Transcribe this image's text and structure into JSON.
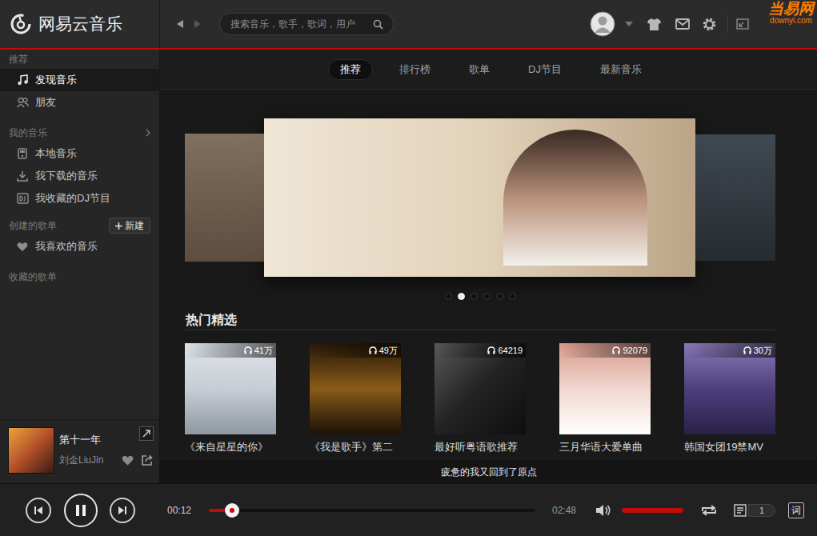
{
  "app": {
    "title": "网易云音乐"
  },
  "watermark": {
    "name": "当易网",
    "url": "downyi.com"
  },
  "search": {
    "placeholder": "搜索音乐，歌手，歌词，用户"
  },
  "sidebar": {
    "sections": [
      {
        "title": "推荐",
        "expandable": false,
        "items": [
          {
            "label": "发现音乐",
            "selected": true
          },
          {
            "label": "朋友",
            "selected": false
          }
        ]
      },
      {
        "title": "我的音乐",
        "expandable": true,
        "items": [
          {
            "label": "本地音乐",
            "selected": false
          },
          {
            "label": "我下载的音乐",
            "selected": false
          },
          {
            "label": "我收藏的DJ节目",
            "selected": false
          }
        ]
      },
      {
        "title": "创建的歌单",
        "expandable": false,
        "button": "新建",
        "items": [
          {
            "label": "我喜欢的音乐",
            "selected": false
          }
        ]
      },
      {
        "title": "收藏的歌单",
        "expandable": false,
        "items": []
      }
    ]
  },
  "tabs": [
    {
      "label": "推荐",
      "selected": true
    },
    {
      "label": "排行榜",
      "selected": false
    },
    {
      "label": "歌单",
      "selected": false
    },
    {
      "label": "DJ节目",
      "selected": false
    },
    {
      "label": "最新音乐",
      "selected": false
    }
  ],
  "carousel": {
    "dots": [
      {
        "selected": false
      },
      {
        "selected": true
      },
      {
        "selected": false
      },
      {
        "selected": false
      },
      {
        "selected": false
      },
      {
        "selected": false
      }
    ]
  },
  "hot": {
    "title": "热门精选",
    "cards": [
      {
        "title": "《来自星星的你》",
        "plays": "41万"
      },
      {
        "title": "《我是歌手》第二",
        "plays": "49万"
      },
      {
        "title": "最好听粤语歌推荐",
        "plays": "64219"
      },
      {
        "title": "三月华语大爱单曲",
        "plays": "92079"
      },
      {
        "title": "韩国女团19禁MV",
        "plays": "30万"
      }
    ]
  },
  "now_playing": {
    "title": "第十一年",
    "artist": "刘金LiuJin",
    "liked": false
  },
  "lyric": "疲惫的我又回到了原点",
  "player": {
    "playing": true,
    "elapsed": "00:12",
    "duration": "02:48",
    "progress": 0.07,
    "volume": 1,
    "playlist_count": "1",
    "lyric_button": "词"
  }
}
